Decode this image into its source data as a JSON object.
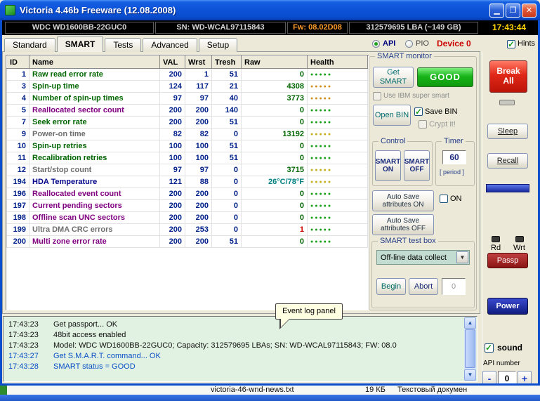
{
  "window": {
    "title": "Victoria 4.46b Freeware (12.08.2008)",
    "icons": {
      "minimize": "▁",
      "maximize": "❐",
      "close": "✕"
    }
  },
  "infobar": {
    "model": "WDC WD1600BB-22GUC0",
    "serial": "SN: WD-WCAL97115843",
    "firmware": "Fw: 08.02D08",
    "capacity": "312579695 LBA (~149 GB)",
    "clock": "17:43:44"
  },
  "tabs": {
    "items": [
      {
        "label": "Standard",
        "active": false
      },
      {
        "label": "SMART",
        "active": true
      },
      {
        "label": "Tests",
        "active": false
      },
      {
        "label": "Advanced",
        "active": false
      },
      {
        "label": "Setup",
        "active": false
      }
    ],
    "api_label": "API",
    "pio_label": "PIO",
    "device_label": "Device 0",
    "hints_label": "Hints"
  },
  "smart_table": {
    "headers": [
      "ID",
      "Name",
      "VAL",
      "Wrst",
      "Tresh",
      "Raw",
      "Health"
    ],
    "dots": "●●●●●",
    "rows": [
      {
        "id": "1",
        "name": "Raw read error rate",
        "val": "200",
        "wrst": "1",
        "tresh": "51",
        "raw": "0",
        "name_color": "#006600",
        "raw_color": "#006600",
        "health_color": "#18A018"
      },
      {
        "id": "3",
        "name": "Spin-up time",
        "val": "124",
        "wrst": "117",
        "tresh": "21",
        "raw": "4308",
        "name_color": "#006600",
        "raw_color": "#006600",
        "health_color": "#D09020"
      },
      {
        "id": "4",
        "name": "Number of spin-up times",
        "val": "97",
        "wrst": "97",
        "tresh": "40",
        "raw": "3773",
        "name_color": "#006600",
        "raw_color": "#006600",
        "health_color": "#D09020"
      },
      {
        "id": "5",
        "name": "Reallocated sector count",
        "val": "200",
        "wrst": "200",
        "tresh": "140",
        "raw": "0",
        "name_color": "#800080",
        "raw_color": "#006600",
        "health_color": "#18A018"
      },
      {
        "id": "7",
        "name": "Seek error rate",
        "val": "200",
        "wrst": "200",
        "tresh": "51",
        "raw": "0",
        "name_color": "#006600",
        "raw_color": "#006600",
        "health_color": "#18A018"
      },
      {
        "id": "9",
        "name": "Power-on time",
        "val": "82",
        "wrst": "82",
        "tresh": "0",
        "raw": "13192",
        "name_color": "#6E6E6E",
        "raw_color": "#006600",
        "health_color": "#C4B020"
      },
      {
        "id": "10",
        "name": "Spin-up retries",
        "val": "100",
        "wrst": "100",
        "tresh": "51",
        "raw": "0",
        "name_color": "#006600",
        "raw_color": "#006600",
        "health_color": "#18A018"
      },
      {
        "id": "11",
        "name": "Recalibration retries",
        "val": "100",
        "wrst": "100",
        "tresh": "51",
        "raw": "0",
        "name_color": "#006600",
        "raw_color": "#006600",
        "health_color": "#18A018"
      },
      {
        "id": "12",
        "name": "Start/stop count",
        "val": "97",
        "wrst": "97",
        "tresh": "0",
        "raw": "3715",
        "name_color": "#6E6E6E",
        "raw_color": "#006600",
        "health_color": "#C4B020"
      },
      {
        "id": "194",
        "name": "HDA Temperature",
        "val": "121",
        "wrst": "88",
        "tresh": "0",
        "raw": "26°C/78°F",
        "name_color": "#00008B",
        "raw_color": "#008080",
        "health_color": "#C4B020"
      },
      {
        "id": "196",
        "name": "Reallocated event count",
        "val": "200",
        "wrst": "200",
        "tresh": "0",
        "raw": "0",
        "name_color": "#800080",
        "raw_color": "#006600",
        "health_color": "#18A018"
      },
      {
        "id": "197",
        "name": "Current pending sectors",
        "val": "200",
        "wrst": "200",
        "tresh": "0",
        "raw": "0",
        "name_color": "#800080",
        "raw_color": "#006600",
        "health_color": "#18A018"
      },
      {
        "id": "198",
        "name": "Offline scan UNC sectors",
        "val": "200",
        "wrst": "200",
        "tresh": "0",
        "raw": "0",
        "name_color": "#800080",
        "raw_color": "#006600",
        "health_color": "#18A018"
      },
      {
        "id": "199",
        "name": "Ultra DMA CRC errors",
        "val": "200",
        "wrst": "253",
        "tresh": "0",
        "raw": "1",
        "name_color": "#6E6E6E",
        "raw_color": "#D00000",
        "health_color": "#18A018"
      },
      {
        "id": "200",
        "name": "Multi zone error rate",
        "val": "200",
        "wrst": "200",
        "tresh": "51",
        "raw": "0",
        "name_color": "#800080",
        "raw_color": "#006600",
        "health_color": "#18A018"
      }
    ]
  },
  "smart_monitor": {
    "title": "SMART monitor",
    "get_smart": "Get SMART",
    "status": "GOOD",
    "use_ibm": "Use IBM super smart",
    "open_bin": "Open BIN",
    "save_bin": "Save BIN",
    "crypt_it": "Crypt it!",
    "control_title": "Control",
    "smart_on": "SMART ON",
    "smart_off": "SMART OFF",
    "timer_title": "Timer",
    "timer_value": "60",
    "timer_period": "[ period ]",
    "autosave_on": "Auto Save attributes ON",
    "autosave_cb": "ON",
    "autosave_off": "Auto Save attributes OFF",
    "testbox_title": "SMART test box",
    "test_selected": "Off-line data collect",
    "dropdown_arrow": "▼",
    "begin": "Begin",
    "abort": "Abort",
    "test_value": "0"
  },
  "sidebar": {
    "break_all": "Break All",
    "sleep": "Sleep",
    "recall": "Recall",
    "rd": "Rd",
    "wrt": "Wrt",
    "passp": "Passp",
    "power": "Power",
    "sound": "sound",
    "api_number_label": "API number",
    "api_number_value": "0",
    "minus": "-",
    "plus": "+"
  },
  "log": {
    "tooltip": "Event log panel",
    "scroll_up": "▲",
    "scroll_down": "▼",
    "lines": [
      {
        "time": "17:43:23",
        "text": "Get passport... OK",
        "color": "#101010"
      },
      {
        "time": "17:43:23",
        "text": "48bit access enabled",
        "color": "#101010"
      },
      {
        "time": "17:43:23",
        "text": "Model: WDC WD1600BB-22GUC0; Capacity: 312579695 LBAs; SN: WD-WCAL97115843; FW: 08.0",
        "color": "#101010"
      },
      {
        "time": "17:43:27",
        "text": "Get S.M.A.R.T. command... OK",
        "color": "#0A50C8"
      },
      {
        "time": "17:43:28",
        "text": "SMART status = GOOD",
        "color": "#0A50C8"
      }
    ]
  },
  "background": {
    "file_name": "victoria-46-wnd-news.txt",
    "file_size": "19 КБ",
    "file_type": "Текстовый докумен"
  }
}
